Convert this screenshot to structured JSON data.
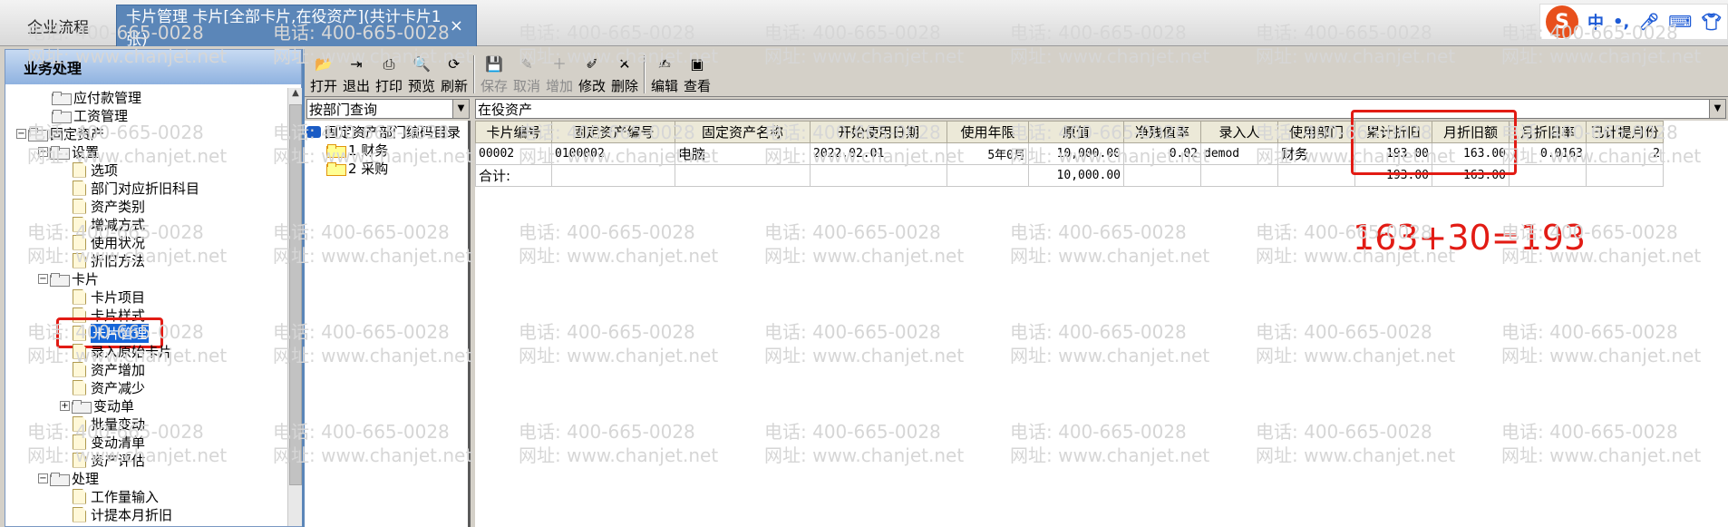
{
  "tabs": {
    "home": "企业流程",
    "active": "卡片管理 卡片[全部卡片,在役资产](共计卡片1张)",
    "close": "×"
  },
  "ime": {
    "chinese_mode": "中",
    "punct": "•,"
  },
  "sidebar": {
    "title": "业务处理",
    "items": [
      {
        "label": "应付款管理",
        "level": 1,
        "type": "folder"
      },
      {
        "label": "工资管理",
        "level": 1,
        "type": "folder"
      },
      {
        "label": "固定资产",
        "level": 0,
        "type": "folder",
        "expanded": true
      },
      {
        "label": "设置",
        "level": 1,
        "type": "folder",
        "expanded": true
      },
      {
        "label": "选项",
        "level": 2,
        "type": "doc"
      },
      {
        "label": "部门对应折旧科目",
        "level": 2,
        "type": "doc"
      },
      {
        "label": "资产类别",
        "level": 2,
        "type": "doc"
      },
      {
        "label": "增减方式",
        "level": 2,
        "type": "doc"
      },
      {
        "label": "使用状况",
        "level": 2,
        "type": "doc"
      },
      {
        "label": "折旧方法",
        "level": 2,
        "type": "doc"
      },
      {
        "label": "卡片",
        "level": 1,
        "type": "folder",
        "expanded": true
      },
      {
        "label": "卡片项目",
        "level": 2,
        "type": "doc"
      },
      {
        "label": "卡片样式",
        "level": 2,
        "type": "doc"
      },
      {
        "label": "卡片管理",
        "level": 2,
        "type": "doc",
        "selected": true
      },
      {
        "label": "录入原始卡片",
        "level": 2,
        "type": "doc"
      },
      {
        "label": "资产增加",
        "level": 2,
        "type": "doc"
      },
      {
        "label": "资产减少",
        "level": 2,
        "type": "doc"
      },
      {
        "label": "变动单",
        "level": 2,
        "type": "folder",
        "collapsed": true
      },
      {
        "label": "批量变动",
        "level": 2,
        "type": "doc"
      },
      {
        "label": "变动清单",
        "level": 2,
        "type": "doc"
      },
      {
        "label": "资产评估",
        "level": 2,
        "type": "doc"
      },
      {
        "label": "处理",
        "level": 1,
        "type": "folder",
        "expanded": true
      },
      {
        "label": "工作量输入",
        "level": 2,
        "type": "doc"
      },
      {
        "label": "计提本月折旧",
        "level": 2,
        "type": "doc"
      }
    ]
  },
  "toolbar": {
    "buttons": [
      {
        "label": "打开",
        "icon": "folder-open-icon",
        "glyph": "📂",
        "enabled": true
      },
      {
        "label": "退出",
        "icon": "exit-icon",
        "glyph": "⇥",
        "enabled": true
      },
      {
        "label": "打印",
        "icon": "printer-icon",
        "glyph": "⎙",
        "enabled": true
      },
      {
        "label": "预览",
        "icon": "preview-icon",
        "glyph": "🔍",
        "enabled": true
      },
      {
        "label": "刷新",
        "icon": "refresh-icon",
        "glyph": "⟳",
        "enabled": true
      },
      {
        "label": "保存",
        "icon": "save-icon",
        "glyph": "💾",
        "enabled": false
      },
      {
        "label": "取消",
        "icon": "cancel-icon",
        "glyph": "✎",
        "enabled": false
      },
      {
        "label": "增加",
        "icon": "add-icon",
        "glyph": "＋",
        "enabled": false
      },
      {
        "label": "修改",
        "icon": "edit-icon",
        "glyph": "✐",
        "enabled": true
      },
      {
        "label": "删除",
        "icon": "delete-icon",
        "glyph": "✕",
        "enabled": true
      },
      {
        "label": "编辑",
        "icon": "compose-icon",
        "glyph": "✍",
        "enabled": true
      },
      {
        "label": "查看",
        "icon": "view-icon",
        "glyph": "▣",
        "enabled": true
      }
    ]
  },
  "filters": {
    "query_by": "按部门查询",
    "asset_status": "在役资产"
  },
  "dept_tree": {
    "root": "固定资产部门编码目录",
    "items": [
      "1 财务",
      "2 采购"
    ]
  },
  "grid": {
    "columns": [
      "卡片编号",
      "固定资产编号",
      "固定资产名称",
      "开始使用日期",
      "使用年限",
      "原值",
      "净残值率",
      "录入人",
      "使用部门",
      "累计折旧",
      "月折旧额",
      "月折旧率",
      "已计提月份"
    ],
    "rows": [
      [
        "00002",
        "0100002",
        "电脑",
        "2022.02.01",
        "5年0月",
        "10,000.00",
        "0.02",
        "demod",
        "财务",
        "193.00",
        "163.00",
        "0.0163",
        "2"
      ]
    ],
    "total": [
      "合计:",
      "",
      "",
      "",
      "",
      "10,000.00",
      "",
      "",
      "",
      "193.00",
      "163.00",
      "",
      ""
    ]
  },
  "annotation": "163+30=193",
  "watermark": {
    "phone": "电话: 400-665-0028",
    "site": "网址: www.chanjet.net"
  },
  "colors": {
    "highlight": "#e21b14",
    "selected": "#1565d8",
    "active_tab": "#5b86b8"
  }
}
